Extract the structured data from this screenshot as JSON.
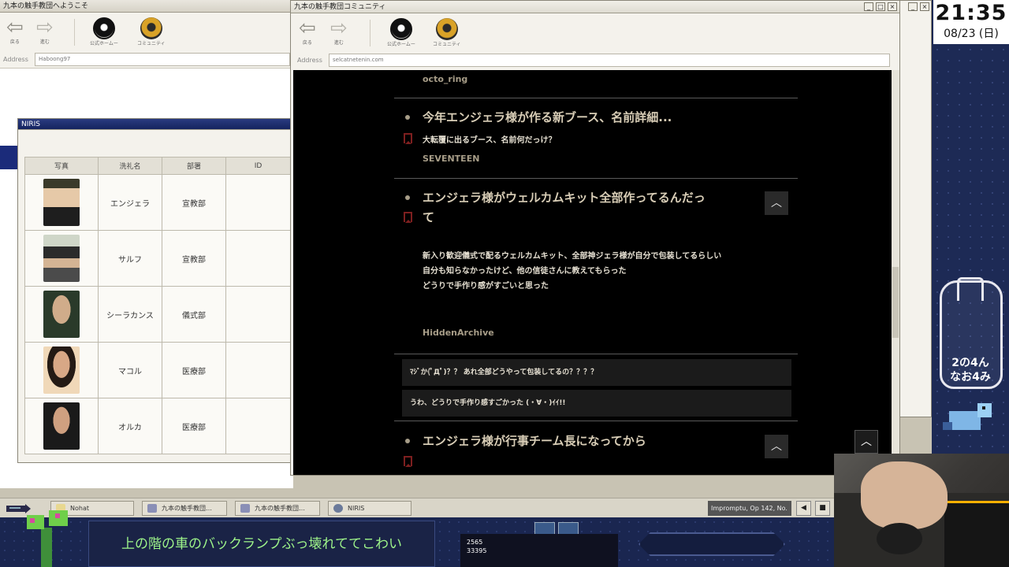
{
  "left_window": {
    "title": "九本の触手教団へようこそ",
    "back_label": "戻る",
    "forward_label": "進む",
    "home_label": "公式ホームー",
    "community_label": "コミュニティ",
    "address_label": "Address",
    "address_value": "Haboong97"
  },
  "niris": {
    "title": "NIRIS",
    "headers": [
      "写真",
      "洗礼名",
      "部署",
      "ID"
    ],
    "rows": [
      {
        "name": "エンジェラ",
        "dept": "宣教部"
      },
      {
        "name": "サルフ",
        "dept": "宣教部"
      },
      {
        "name": "シーラカンス",
        "dept": "儀式部"
      },
      {
        "name": "マコル",
        "dept": "医療部"
      },
      {
        "name": "オルカ",
        "dept": "医療部"
      }
    ]
  },
  "comm_window": {
    "title": "九本の触手教団コミュニティ",
    "back_label": "戻る",
    "forward_label": "進む",
    "home_label": "公式ホームー",
    "community_label": "コミュニティ",
    "address_label": "Address",
    "address_value": "selcatnetenin.com"
  },
  "posts": {
    "prev_author": "octo_ring",
    "p1": {
      "title": "今年エンジェラ様が作る新ブース、名前詳細...",
      "sub": "大転覆に出るブース、名前何だっけ？",
      "author": "SEVENTEEN"
    },
    "p2": {
      "title_l1": "エンジェラ様がウェルカムキット全部作ってるんだっ",
      "title_l2": "て",
      "body_l1": "新入り歓迎儀式で配るウェルカムキット、全部神ジェラ様が自分で包装してるらしい",
      "body_l2": "自分も知らなかったけど、他の信徒さんに教えてもらった",
      "body_l3": "どうりで手作り感がすごいと思った",
      "author": "HiddenArchive",
      "comment1": "ﾏｼﾞか(ﾟДﾟ)？？ あれ全部どうやって包装してるの？？？？",
      "comment2": "うわ、どうりで手作り感すごかった (・∀・)ｲｲ!!"
    },
    "p3": {
      "title": "エンジェラ様が行事チーム長になってから"
    },
    "collapse_glyph": "︿"
  },
  "clock": {
    "time": "21:35",
    "date": "08/23 (日)"
  },
  "taskbar": {
    "items": [
      "Nohat",
      "九本の触手教団…",
      "九本の触手教団…",
      "NIRIS"
    ],
    "music": "Impromptu, Op 142, No.",
    "prev_glyph": "◀",
    "stop_glyph": "■"
  },
  "stream": {
    "subtitle": "上の階の車のバックランプぶっ壊れててこわい",
    "logo_line1": "2の4ん",
    "logo_line2": "なお4み",
    "game_num1": "2565",
    "game_num2": "33395"
  },
  "colors": {
    "post_title": "#d8cdb6",
    "author": "#a79d88",
    "subtitle_text": "#9ef58a",
    "accent_navy": "#1b2b7a"
  }
}
